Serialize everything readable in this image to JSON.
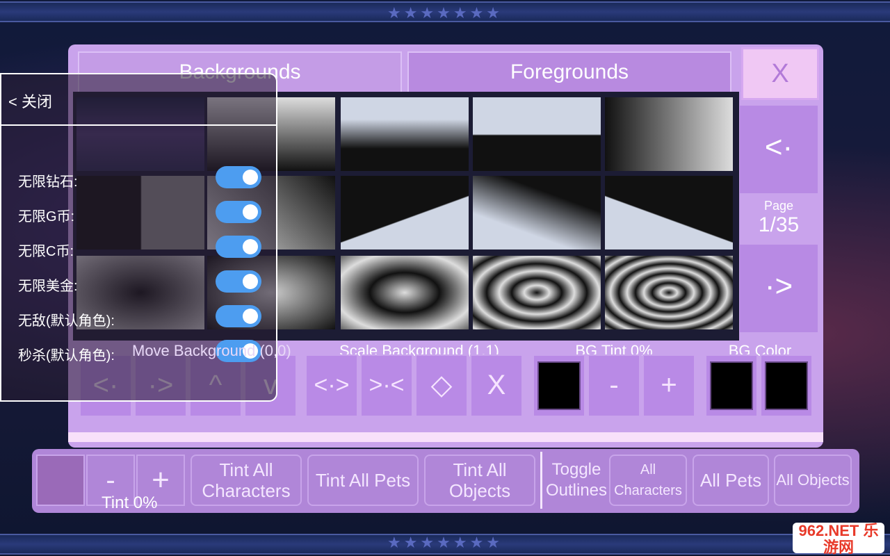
{
  "tabs": {
    "backgrounds": "Backgrounds",
    "foregrounds": "Foregrounds",
    "close": "X"
  },
  "pager": {
    "page_label": "Page",
    "page_value": "1/35",
    "prev": "<·",
    "next": "·>"
  },
  "controls": {
    "move_label": "Move Background (0,0)",
    "scale_label": "Scale Background (1,1)",
    "tint_label": "BG Tint 0%",
    "color_label": "BG Color",
    "move_buttons": [
      "<·",
      "·>",
      "^",
      "v"
    ],
    "scale_buttons": [
      "<·>",
      ">·<",
      "◇",
      "X"
    ],
    "tint_minus": "-",
    "tint_plus": "+"
  },
  "bottom": {
    "minus": "-",
    "plus": "+",
    "tint": "Tint 0%",
    "buttons": [
      "Tint All Characters",
      "Tint All Pets",
      "Tint All Objects",
      "Toggle Outlines",
      "All Characters",
      "All Pets",
      "All Objects"
    ]
  },
  "overlay": {
    "back": "< 关闭",
    "items": [
      {
        "label": "无限钻石:",
        "on": true
      },
      {
        "label": "无限G币:",
        "on": true
      },
      {
        "label": "无限C币:",
        "on": true
      },
      {
        "label": "无限美金:",
        "on": true
      },
      {
        "label": "无敌(默认角色):",
        "on": true
      },
      {
        "label": "秒杀(默认角色):",
        "on": true
      }
    ]
  },
  "watermark": "962.NET 乐游网",
  "colors": {
    "panel": "#c9a3ec",
    "button": "#b98ae6",
    "toggle": "#4d9df0"
  }
}
